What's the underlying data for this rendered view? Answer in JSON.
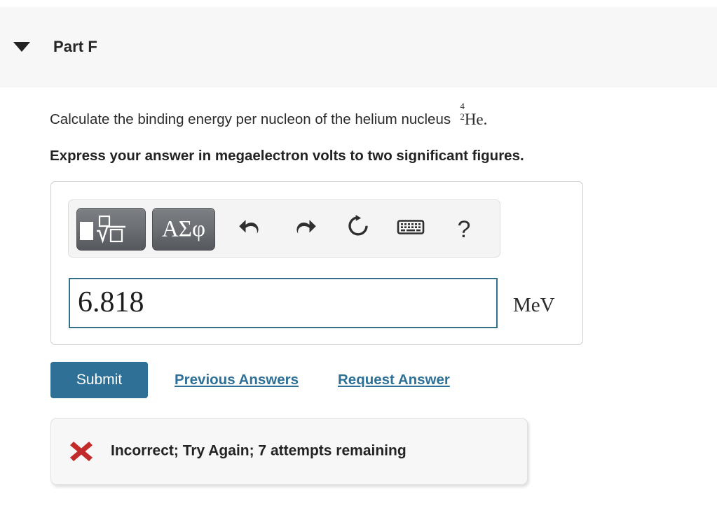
{
  "header": {
    "title": "Part F",
    "collapse_icon": "caret-down-icon",
    "background": "#f7f7f7"
  },
  "question": {
    "text_before": "Calculate the binding energy per nucleon of the helium nucleus",
    "isotope": {
      "mass_number": "4",
      "atomic_number": "2",
      "symbol": "He"
    },
    "text_after": ".",
    "instruction": "Express your answer in megaelectron volts to two significant figures."
  },
  "answer": {
    "toolbar": {
      "template_button": {
        "name": "math-template-button",
        "icon": "square-root-template-icon"
      },
      "greek_button": {
        "name": "greek-symbols-button",
        "label": "ΑΣφ"
      },
      "undo_button": "undo-icon",
      "redo_button": "redo-icon",
      "reset_button": "reset-icon",
      "keyboard_button": "keyboard-icon",
      "help_button": "?"
    },
    "input_value": "6.818",
    "input_placeholder": "",
    "unit": "MeV",
    "border_color": "#33708a"
  },
  "actions": {
    "submit_label": "Submit",
    "submit_color": "#2e7096",
    "previous_answers_label": "Previous Answers",
    "request_answer_label": "Request Answer",
    "link_color": "#2e7096"
  },
  "feedback": {
    "status_icon": "red-x-icon",
    "status_color": "#c32a2a",
    "message": "Incorrect; Try Again; 7 attempts remaining",
    "attempts_remaining": "7"
  }
}
